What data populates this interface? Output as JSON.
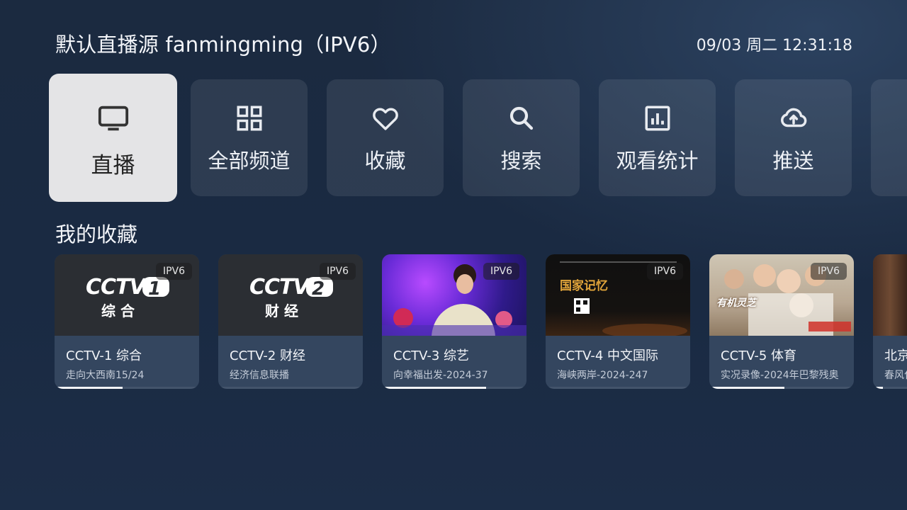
{
  "header": {
    "title": "默认直播源 fanmingming（IPV6）",
    "datetime": "09/03 周二 12:31:18"
  },
  "menu": [
    {
      "label": "直播",
      "icon": "tv-icon",
      "active": true
    },
    {
      "label": "全部频道",
      "icon": "grid-icon",
      "active": false
    },
    {
      "label": "收藏",
      "icon": "heart-icon",
      "active": false
    },
    {
      "label": "搜索",
      "icon": "search-icon",
      "active": false
    },
    {
      "label": "观看统计",
      "icon": "bar-chart-icon",
      "active": false
    },
    {
      "label": "推送",
      "icon": "cloud-upload-icon",
      "active": false
    }
  ],
  "favorites": {
    "title": "我的收藏",
    "items": [
      {
        "name": "CCTV-1 综合",
        "program": "走向大西南15/24",
        "badge": "IPV6",
        "progress": 0.47,
        "logo_number": "1",
        "logo_caption": "综 合"
      },
      {
        "name": "CCTV-2 财经",
        "program": "经济信息联播",
        "badge": "IPV6",
        "progress": 0.0,
        "logo_number": "2",
        "logo_caption": "财 经"
      },
      {
        "name": "CCTV-3 综艺",
        "program": "向幸福出发-2024-37",
        "badge": "IPV6",
        "progress": 0.72
      },
      {
        "name": "CCTV-4 中文国际",
        "program": "海峡两岸-2024-247",
        "badge": "IPV6",
        "progress": 0.0,
        "thumb_text": "国家记忆"
      },
      {
        "name": "CCTV-5 体育",
        "program": "实况录像-2024年巴黎残奥",
        "badge": "IPV6",
        "progress": 0.52,
        "thumb_text": "有机灵芝"
      },
      {
        "name": "北京",
        "program": "春风化",
        "badge": "",
        "progress": 0.3
      }
    ]
  },
  "colors": {
    "background": "#1b2a40",
    "tile": "#2f3f56",
    "tile_active": "#e4e4e6",
    "card_info": "#34465f"
  }
}
